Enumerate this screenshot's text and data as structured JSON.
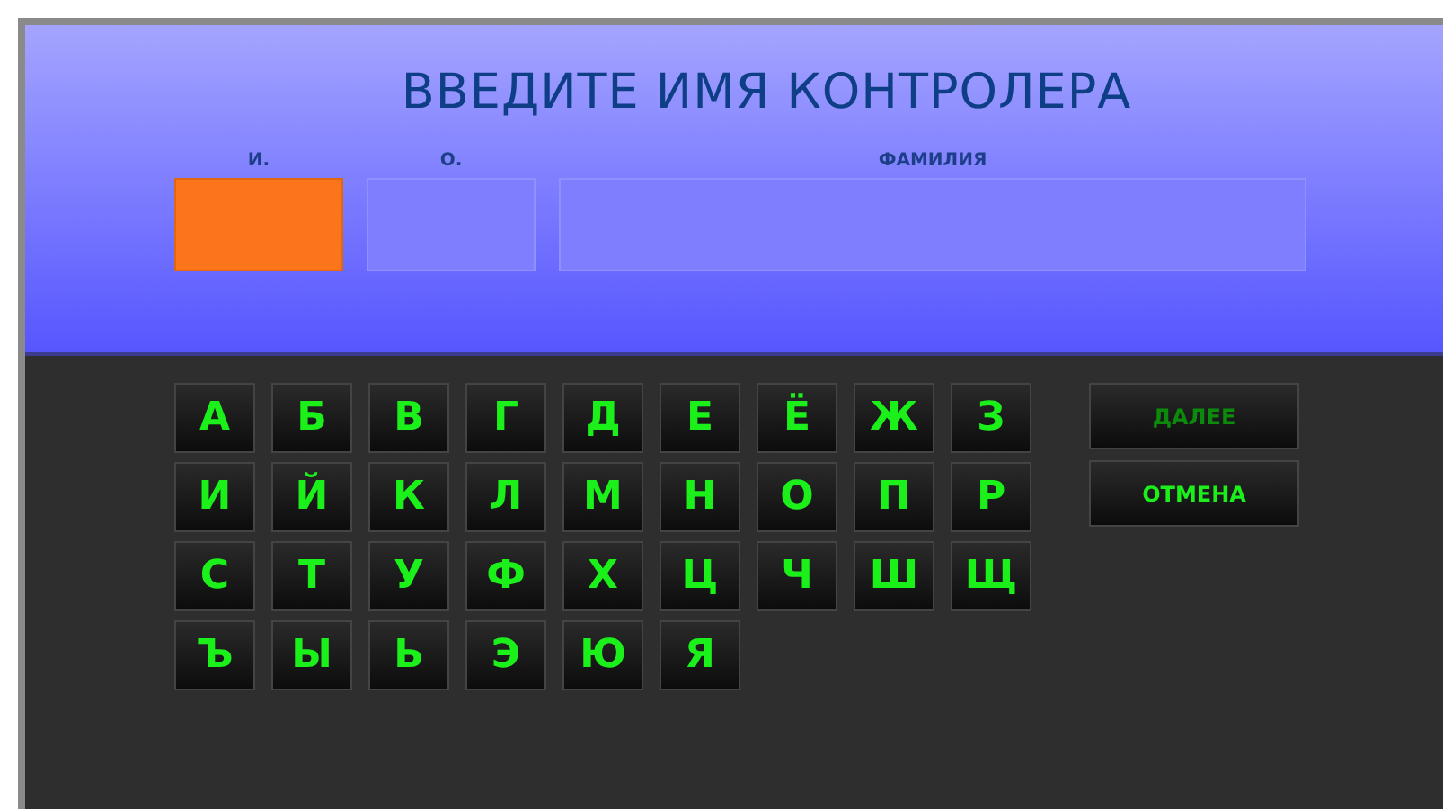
{
  "title": "ВВЕДИТЕ ИМЯ КОНТРОЛЕРА",
  "fields": [
    {
      "label": "И.",
      "selected": true
    },
    {
      "label": "О.",
      "selected": false
    },
    {
      "label": "ФАМИЛИЯ",
      "selected": false
    }
  ],
  "keys": [
    [
      "А",
      "Б",
      "В",
      "Г",
      "Д",
      "Е",
      "Ё",
      "Ж",
      "З"
    ],
    [
      "И",
      "Й",
      "К",
      "Л",
      "М",
      "Н",
      "О",
      "П",
      "Р"
    ],
    [
      "С",
      "Т",
      "У",
      "Ф",
      "Х",
      "Ц",
      "Ч",
      "Ш",
      "Щ"
    ],
    [
      "Ъ",
      "Ы",
      "Ь",
      "Э",
      "Ю",
      "Я"
    ]
  ],
  "buttons": [
    {
      "label": "ДАЛЕЕ",
      "disabled": true
    },
    {
      "label": "ОТМЕНА",
      "disabled": false
    }
  ]
}
